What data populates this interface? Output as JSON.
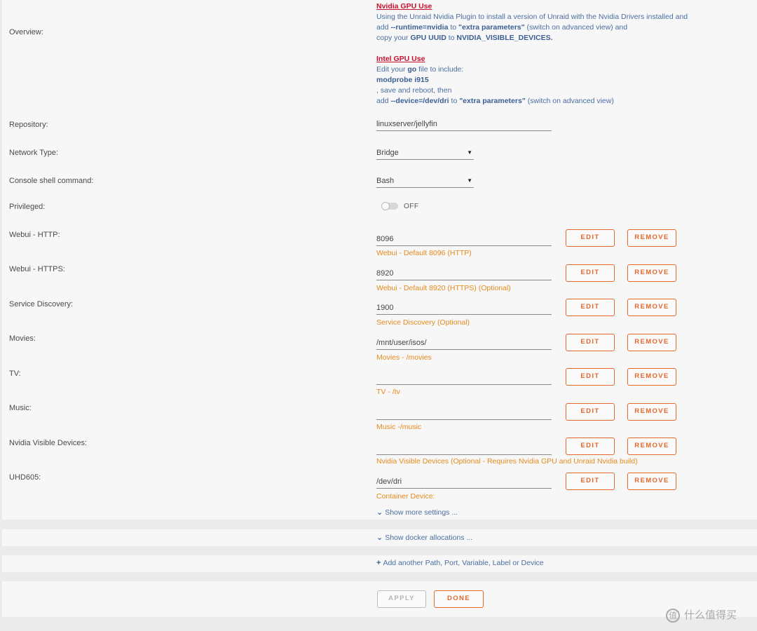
{
  "overview": {
    "label": "Overview:",
    "nvidia_head": "Nvidia GPU Use",
    "nvidia_l1": "Using the Unraid Nvidia Plugin to install a version of Unraid with the Nvidia Drivers installed and",
    "nvidia_l2_a": "add ",
    "nvidia_l2_b": "--runtime=nvidia",
    "nvidia_l2_c": " to ",
    "nvidia_l2_d": "\"extra parameters\"",
    "nvidia_l2_e": " (switch on advanced view) and",
    "nvidia_l3_a": "copy your ",
    "nvidia_l3_b": "GPU UUID",
    "nvidia_l3_c": " to ",
    "nvidia_l3_d": "NVIDIA_VISIBLE_DEVICES.",
    "intel_head": "Intel GPU Use",
    "intel_l1_a": "Edit your ",
    "intel_l1_b": "go",
    "intel_l1_c": " file to include:",
    "intel_l2": "modprobe i915",
    "intel_l3": ", save and reboot, then",
    "intel_l4_a": "add ",
    "intel_l4_b": "--device=/dev/dri",
    "intel_l4_c": " to ",
    "intel_l4_d": "\"extra parameters\"",
    "intel_l4_e": " (switch on advanced view)"
  },
  "repository": {
    "label": "Repository:",
    "value": "linuxserver/jellyfin"
  },
  "network": {
    "label": "Network Type:",
    "value": "Bridge"
  },
  "console": {
    "label": "Console shell command:",
    "value": "Bash"
  },
  "privileged": {
    "label": "Privileged:",
    "state": "OFF"
  },
  "buttons": {
    "edit": "EDIT",
    "remove": "REMOVE",
    "apply": "APPLY",
    "done": "DONE"
  },
  "configs": [
    {
      "label": "Webui - HTTP:",
      "value": "8096",
      "hint": "Webui - Default 8096 (HTTP)"
    },
    {
      "label": "Webui - HTTPS:",
      "value": "8920",
      "hint": "Webui - Default 8920 (HTTPS) (Optional)"
    },
    {
      "label": "Service Discovery:",
      "value": "1900",
      "hint": "Service Discovery (Optional)"
    },
    {
      "label": "Movies:",
      "value": "/mnt/user/isos/",
      "hint": "Movies - /movies"
    },
    {
      "label": "TV:",
      "value": "",
      "hint": "TV - /tv"
    },
    {
      "label": "Music:",
      "value": "",
      "hint": "Music -/music"
    },
    {
      "label": "Nvidia Visible Devices:",
      "value": "",
      "hint": "Nvidia Visible Devices (Optional - Requires Nvidia GPU and Unraid Nvidia build)"
    },
    {
      "label": "UHD605:",
      "value": "/dev/dri",
      "hint": "Container Device:"
    }
  ],
  "links": {
    "show_more": "Show more settings ...",
    "show_alloc": "Show docker allocations ...",
    "add_another": "Add another Path, Port, Variable, Label or Device"
  },
  "watermark": {
    "text": "什么值得买",
    "icon": "值"
  },
  "colors": {
    "accent": "#e4672c",
    "hint": "#e68a1c",
    "link": "#4a6ea0",
    "gpu_head": "#c8102e"
  }
}
